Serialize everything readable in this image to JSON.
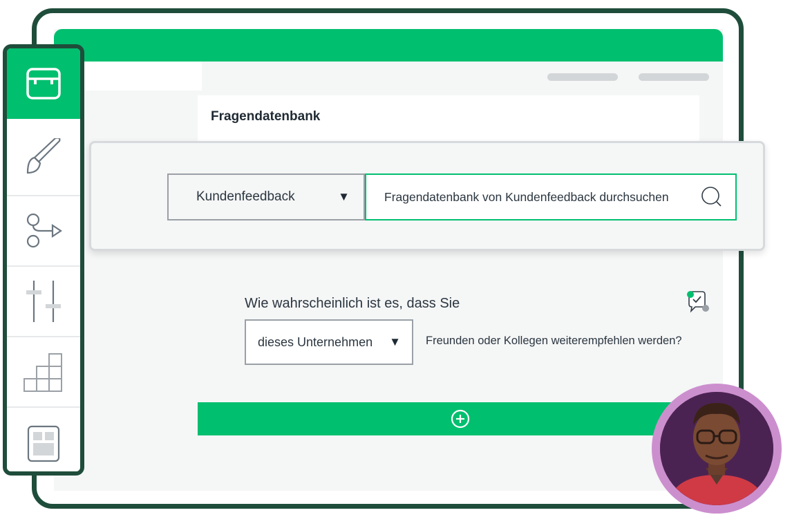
{
  "app": {
    "title": "Fragendatenbank"
  },
  "sidebar": {
    "items": [
      {
        "name": "question-bank-icon",
        "active": true
      },
      {
        "name": "design-brush-icon",
        "active": false
      },
      {
        "name": "logic-branch-icon",
        "active": false
      },
      {
        "name": "settings-sliders-icon",
        "active": false
      },
      {
        "name": "analyze-chart-icon",
        "active": false
      },
      {
        "name": "layout-template-icon",
        "active": false
      }
    ]
  },
  "question_bank": {
    "category": "Kundenfeedback",
    "search_placeholder": "Fragendatenbank von Kundenfeedback durchsuchen"
  },
  "question": {
    "prefix": "Wie wahrscheinlich ist es, dass Sie",
    "selected_option": "dieses Unternehmen",
    "suffix": "Freunden oder Kollegen weiterempfehlen werden?"
  },
  "colors": {
    "brand_green": "#00bf6f",
    "frame_dark_green": "#1f4d3b",
    "avatar_ring": "#cc8fce"
  }
}
